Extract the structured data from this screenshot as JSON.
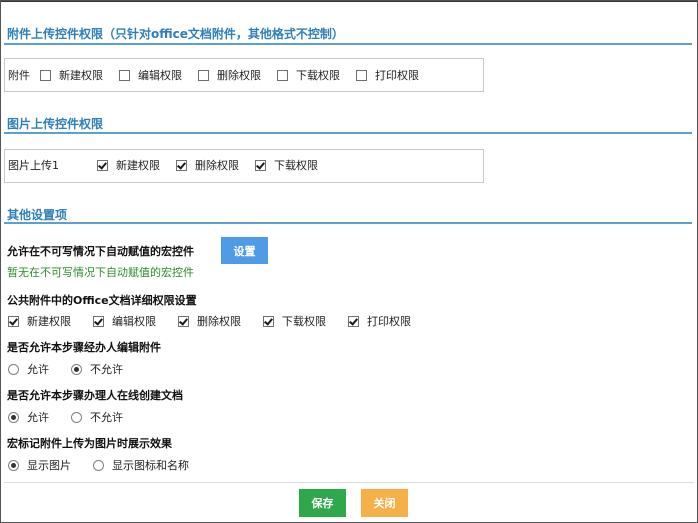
{
  "section_attach": {
    "title": "附件上传控件权限（只针对office文档附件，其他格式不控制）",
    "row_label": "附件",
    "options": [
      {
        "label": "新建权限",
        "checked": false
      },
      {
        "label": "编辑权限",
        "checked": false
      },
      {
        "label": "删除权限",
        "checked": false
      },
      {
        "label": "下载权限",
        "checked": false
      },
      {
        "label": "打印权限",
        "checked": false
      }
    ]
  },
  "section_image": {
    "title": "图片上传控件权限",
    "row_label": "图片上传1",
    "options": [
      {
        "label": "新建权限",
        "checked": true
      },
      {
        "label": "删除权限",
        "checked": true
      },
      {
        "label": "下载权限",
        "checked": true
      }
    ]
  },
  "section_other": {
    "title": "其他设置项",
    "macro_label": "允许在不可写情况下自动赋值的宏控件",
    "set_button": "设置",
    "macro_none_text": "暂无在不可写情况下自动赋值的宏控件",
    "public_attach_label": "公共附件中的Office文档详细权限设置",
    "public_options": [
      {
        "label": "新建权限",
        "checked": true
      },
      {
        "label": "编辑权限",
        "checked": true
      },
      {
        "label": "删除权限",
        "checked": true
      },
      {
        "label": "下载权限",
        "checked": true
      },
      {
        "label": "打印权限",
        "checked": true
      }
    ],
    "q1": {
      "label": "是否允许本步骤经办人编辑附件",
      "options": [
        {
          "label": "允许",
          "checked": false
        },
        {
          "label": "不允许",
          "checked": true
        }
      ]
    },
    "q2": {
      "label": "是否允许本步骤办理人在线创建文档",
      "options": [
        {
          "label": "允许",
          "checked": true
        },
        {
          "label": "不允许",
          "checked": false
        }
      ]
    },
    "q3": {
      "label": "宏标记附件上传为图片时展示效果",
      "options": [
        {
          "label": "显示图片",
          "checked": true
        },
        {
          "label": "显示图标和名称",
          "checked": false
        }
      ]
    }
  },
  "footer": {
    "save_label": "保存",
    "close_label": "关闭"
  },
  "colors": {
    "section_title": "#2f7fb8",
    "save": "#2ea84a",
    "close": "#f6b04a",
    "set": "#4f9be5",
    "green_text": "#2e8b2e"
  }
}
